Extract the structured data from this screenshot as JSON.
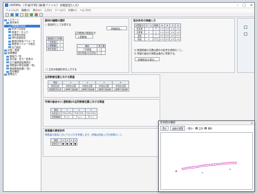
{
  "window": {
    "title": "HORIMa - [平成/不明] [新規ファイル] - 詳細設定(入力)",
    "controls": [
      "–",
      "□",
      "×"
    ]
  },
  "menu": [
    "ファイル(F)",
    "編集(E)",
    "表示(V)",
    "入力(I)",
    "ツール(T)",
    "計算(C)",
    "ヘルプ(H)"
  ],
  "sidebar": {
    "items": [
      {
        "label": "入力モード",
        "level": 0
      },
      {
        "label": "基本条件",
        "level": 1
      },
      {
        "label": "詳細条件設定",
        "level": 2,
        "selected": true
      },
      {
        "label": "形状寸法設定",
        "level": 2
      },
      {
        "label": "荷重データ入力",
        "level": 2
      },
      {
        "label": "支承条件設定",
        "level": 2
      },
      {
        "label": "材料定数設定",
        "level": 2
      },
      {
        "label": "断面計算用パラメータ",
        "level": 2
      },
      {
        "label": "照査用パラメータ設定",
        "level": 2
      },
      {
        "label": "出力設定",
        "level": 2
      },
      {
        "label": "計算・照査",
        "level": 0
      },
      {
        "label": "結果確認",
        "level": 0
      },
      {
        "label": "断面力一覧",
        "level": 1
      },
      {
        "label": "変位量・反力一覧表示",
        "level": 1
      },
      {
        "label": "応力度照査結果表示",
        "level": 1
      },
      {
        "label": "鉄筋量の算定結果(一覧)",
        "level": 1
      },
      {
        "label": "断面照査結果(一覧)",
        "level": 1
      },
      {
        "label": "図化確認",
        "level": 1
      },
      {
        "label": "帳票出力",
        "level": 0
      }
    ]
  },
  "panel_top_left": {
    "title": "部材の種類の選択",
    "radio1": "○ 梁部材として計算する",
    "btn_detail": "詳細設定...",
    "group_title": "主桁断面の構造区分",
    "table_head": [
      "構造区分",
      "桁数"
    ],
    "rows": [
      [
        "Ｔ型断面",
        "3"
      ],
      [
        "Ｌ型断面",
        "2"
      ],
      [
        "箱桁断面",
        "1"
      ]
    ],
    "select_value": "Ｌ型断面",
    "mini_head": [
      "種別",
      "有",
      "無"
    ],
    "mini_rows": [
      [
        "Ｔ桁断面",
        "✓",
        ""
      ],
      [
        "箱桁断面(中空床版)",
        "✓",
        ""
      ]
    ],
    "check_note": "□ 主桁の断面形状を入力する"
  },
  "panel_top_right": {
    "title": "設計条件の詳細入力",
    "heads": [
      "計算区分",
      "ケース",
      "荷重",
      "M",
      "N",
      "S",
      "θ"
    ],
    "rows": [
      [
        "死荷重",
        "1",
        "Ｄ",
        "1.0",
        "1.0",
        "1.0",
        "1.0"
      ],
      [
        "活荷重",
        "2",
        "Ｌ",
        "1.0",
        "1.0",
        "1.0",
        "1.0"
      ],
      [
        "温度",
        "3",
        "Ｔ",
        "0.5",
        "0.5",
        "0.5",
        "0.5"
      ],
      [
        "地震",
        "4",
        "ＥＱ",
        "1.0",
        "1.0",
        "1.0",
        "1.0"
      ]
    ],
    "notes": [
      "1) 照査断面の位置は図中の記号を参照のこと。",
      "2) 荷重の組合せ係数は道示に準拠する。"
    ],
    "btn_setting": "詳細設定の表示..."
  },
  "panel_mid": {
    "title": "主桁断面位置における照査",
    "heads": [
      "項目",
      "1",
      "2",
      "3",
      "4"
    ],
    "rows": [
      [
        "照査位置",
        "中間支点部",
        "中間支点部",
        "中間支点部",
        "中間支点部"
      ],
      [
        "断面照査位置",
        "上縁側引張鉄筋",
        "上縁側引張鉄筋",
        "上縁側引張鉄筋",
        "上縁側引張鉄筋"
      ]
    ]
  },
  "panel_low": {
    "title": "作用の組合せ(Ｌ型断面)の主桁断面位置における照査",
    "heads": [
      "項目",
      "1",
      "2",
      "3"
    ],
    "rows": [
      [
        "判定区分",
        "ＯＫ(ＯＫ)",
        "ＯＫ(ＯＫ)",
        "ＯＫ(ＯＫ)"
      ],
      [
        "荷重種類",
        "Ｄ＋Ｌ",
        "Ｄ＋Ｌ",
        "Ｄ＋Ｌ"
      ]
    ]
  },
  "panel_bottom": {
    "title": "鉄筋量の算定条件",
    "note": "鉄筋量の算定においてかぶりを考慮します。詳細は別途入力を参照のこと。",
    "heads": [
      "項目",
      "1",
      "2",
      "3",
      "4"
    ],
    "row": [
      "配筋区分",
      "■",
      "■",
      "■",
      "■"
    ]
  },
  "dialog": {
    "title": "形状図の確認",
    "tools": [
      "表示",
      "画面の調整",
      "─表示─"
    ],
    "legend": [
      "主桁",
      "横桁"
    ],
    "close": "×"
  },
  "colors": {
    "accent": "#3a7bd5",
    "curve": "#e040c8"
  }
}
